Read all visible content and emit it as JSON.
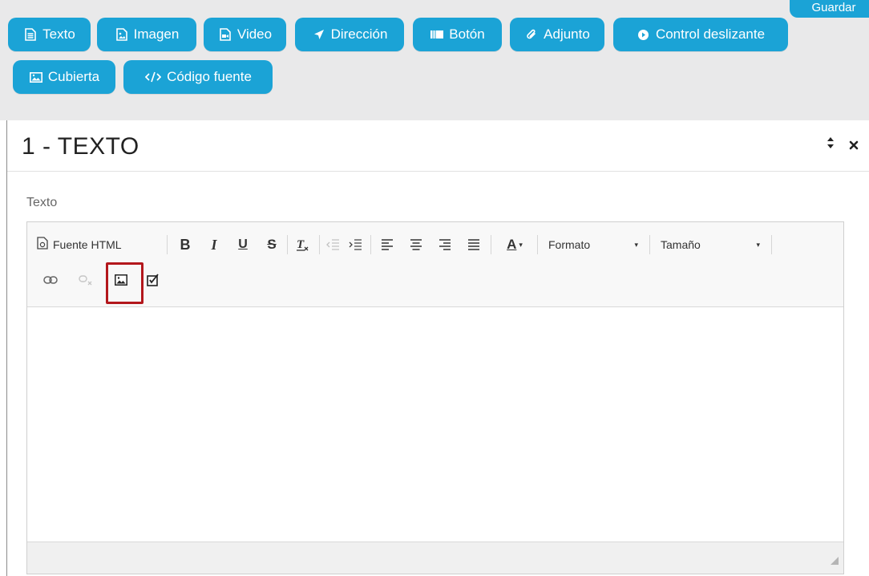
{
  "header": {
    "save_label": "Guardar",
    "blocks": [
      {
        "label": "Texto",
        "icon": "file-text-icon"
      },
      {
        "label": "Imagen",
        "icon": "file-image-icon"
      },
      {
        "label": "Video",
        "icon": "file-video-icon"
      },
      {
        "label": "Dirección",
        "icon": "location-arrow-icon"
      },
      {
        "label": "Botón",
        "icon": "button-bar-icon"
      },
      {
        "label": "Adjunto",
        "icon": "paperclip-icon"
      },
      {
        "label": "Control deslizante",
        "icon": "play-circle-icon"
      },
      {
        "label": "Cubierta",
        "icon": "picture-icon"
      },
      {
        "label": "Código fuente",
        "icon": "code-icon"
      }
    ]
  },
  "panel": {
    "title": "1 - TEXTO",
    "field_label": "Texto"
  },
  "editor": {
    "source_label": "Fuente HTML",
    "format_label": "Formato",
    "size_label": "Tamaño",
    "toolbar_icons": [
      "source-icon",
      "bold-icon",
      "italic-icon",
      "underline-icon",
      "strikethrough-icon",
      "remove-format-icon",
      "outdent-icon",
      "indent-icon",
      "align-left-icon",
      "align-center-icon",
      "align-right-icon",
      "align-justify-icon",
      "text-color-icon",
      "link-icon",
      "unlink-icon",
      "image-icon",
      "checkbox-icon"
    ],
    "highlighted_button": "image-icon",
    "highlight_color": "#b3171c",
    "accent_color": "#1ba3d6"
  }
}
